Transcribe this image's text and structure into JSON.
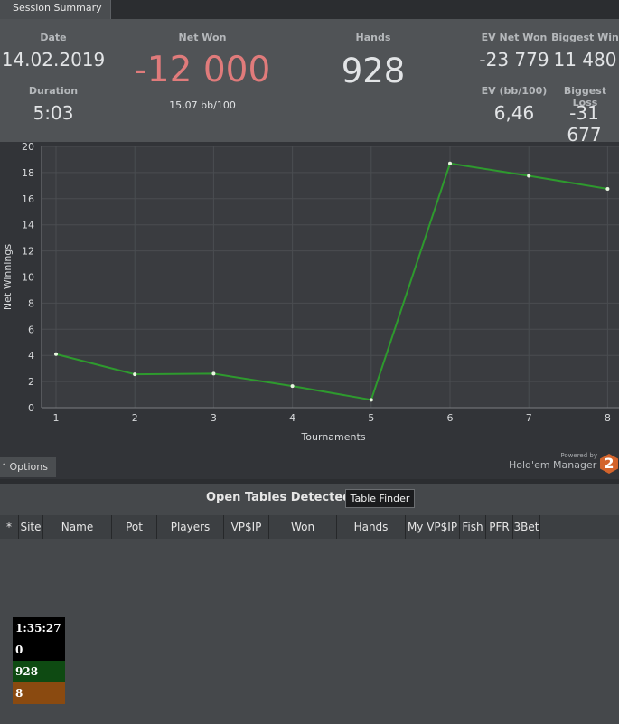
{
  "tab": {
    "label": "Session Summary"
  },
  "summary": {
    "date": {
      "label": "Date",
      "value": "14.02.2019"
    },
    "duration": {
      "label": "Duration",
      "value": "5:03"
    },
    "net_won": {
      "label": "Net Won",
      "value": "-12 000",
      "sub": "15,07 bb/100",
      "color": "#e07b7b"
    },
    "hands": {
      "label": "Hands",
      "value": "928"
    },
    "ev_net_won": {
      "label": "EV Net Won",
      "value": "-23 779"
    },
    "biggest_win": {
      "label": "Biggest Win",
      "value": "11 480"
    },
    "ev_bb100": {
      "label": "EV (bb/100)",
      "value": "6,46"
    },
    "biggest_loss": {
      "label": "Biggest Loss",
      "value": "-31 677"
    }
  },
  "chart_data": {
    "type": "line",
    "x": [
      1,
      2,
      3,
      4,
      5,
      6,
      7,
      8
    ],
    "series": [
      {
        "values": [
          4.1,
          2.55,
          2.6,
          1.65,
          0.6,
          18.7,
          17.75,
          16.75
        ]
      }
    ],
    "xlabel": "Tournaments",
    "ylabel": "Net Winnings",
    "xlim": [
      1,
      8
    ],
    "ylim": [
      0,
      20
    ],
    "yticks": [
      0,
      2,
      4,
      6,
      8,
      10,
      12,
      14,
      16,
      18,
      20
    ],
    "xticks": [
      1,
      2,
      3,
      4,
      5,
      6,
      7,
      8
    ],
    "grid": true,
    "line_color": "#2e9a2e"
  },
  "options": {
    "label": "Options",
    "chevron": "chevron-up-icon"
  },
  "branding": {
    "powered_by": "Powered by",
    "name": "Hold'em Manager",
    "logo_text": "2",
    "logo_color": "#d3642c"
  },
  "open_tables": {
    "title": "Open Tables Detected",
    "finder_button": "Table Finder",
    "columns": [
      "*",
      "Site",
      "Name",
      "Pot",
      "Players",
      "VP$IP",
      "Won",
      "Hands",
      "My VP$IP",
      "Fish",
      "PFR",
      "3Bet"
    ]
  },
  "hud": {
    "time": "1:35:27",
    "value1": "0",
    "hands": "928",
    "value3": "8",
    "colors": {
      "time": "#000000",
      "value1": "#000000",
      "hands": "#0e4a12",
      "value3": "#8a4a10"
    }
  }
}
